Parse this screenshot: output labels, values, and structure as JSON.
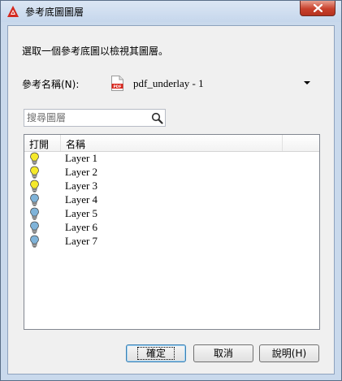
{
  "window": {
    "title": "參考底圖圖層",
    "icon": "autocad-logo-icon",
    "close_icon": "close-icon"
  },
  "dialog": {
    "instruction": "選取一個參考底圖以檢視其圖層。",
    "reference_label": "參考名稱(N):",
    "reference_value": "pdf_underlay - 1",
    "reference_icon": "pdf-file-icon"
  },
  "search": {
    "placeholder": "搜尋圖層",
    "icon": "search-icon"
  },
  "layer_list": {
    "columns": [
      "打開",
      "名稱"
    ],
    "rows": [
      {
        "name": "Layer 1",
        "on": true
      },
      {
        "name": "Layer 2",
        "on": true
      },
      {
        "name": "Layer 3",
        "on": true
      },
      {
        "name": "Layer 4",
        "on": false
      },
      {
        "name": "Layer 5",
        "on": false
      },
      {
        "name": "Layer 6",
        "on": false
      },
      {
        "name": "Layer 7",
        "on": false
      }
    ]
  },
  "buttons": {
    "ok": "確定",
    "cancel": "取消",
    "help": "說明(H)"
  },
  "colors": {
    "bulb_on": "#f5e92a",
    "bulb_off": "#7fb3d9",
    "accent": "#3c7fb1"
  }
}
